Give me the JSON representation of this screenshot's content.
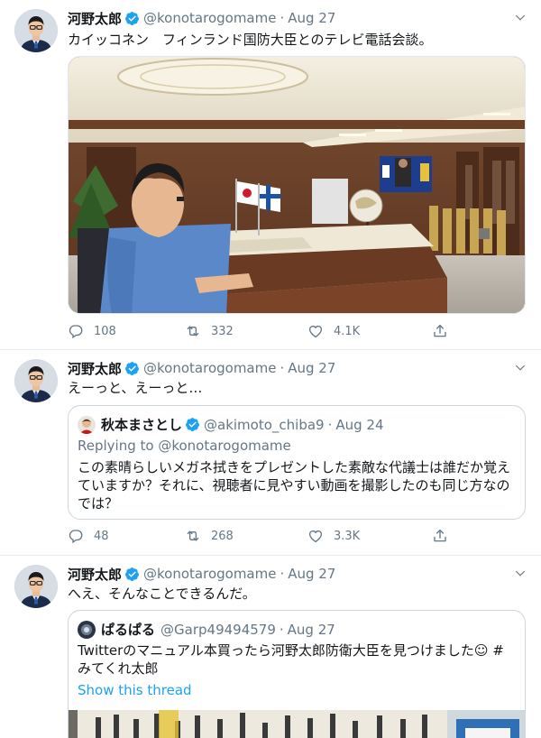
{
  "tweets": [
    {
      "name": "河野太郎",
      "handle": "@konotarogomame",
      "sep": "·",
      "time": "Aug 27",
      "text": "カイッコネン　フィンランド国防大臣とのテレビ電話会談。",
      "image_alt": "Video call meeting in office with Japanese and Finnish flags",
      "replies": "108",
      "retweets": "332",
      "likes": "4.1K"
    },
    {
      "name": "河野太郎",
      "handle": "@konotarogomame",
      "sep": "·",
      "time": "Aug 27",
      "text": "えーっと、えーっと…",
      "quote": {
        "name": "秋本まさとし",
        "handle": "@akimoto_chiba9",
        "sep": "·",
        "time": "Aug 24",
        "replying": "Replying to @konotarogomame",
        "text_lines": [
          "この素晴らしいメガネ拭きをプレゼントした素敵な代議士は誰だか覚え",
          "ていますか？それに、視聴者に見やすい動画を撮影したのも同じ方なの",
          "では？"
        ]
      },
      "replies": "48",
      "retweets": "268",
      "likes": "3.3K"
    },
    {
      "name": "河野太郎",
      "handle": "@konotarogomame",
      "sep": "·",
      "time": "Aug 27",
      "text": "へえ、そんなことできるんだ。",
      "quote": {
        "name": "ぱるぱる",
        "handle": "@Garp49494579",
        "sep": "·",
        "time": "Aug 27",
        "text_lines": [
          "Twitterのマニュアル本買ったら河野太郎防衛大臣を見つけました☺ #",
          "みてくれ太郎"
        ],
        "show_thread": "Show this thread"
      }
    }
  ],
  "colors": {
    "link": "#1da1f2",
    "secondary": "#657786",
    "border": "#e6ecf0"
  }
}
